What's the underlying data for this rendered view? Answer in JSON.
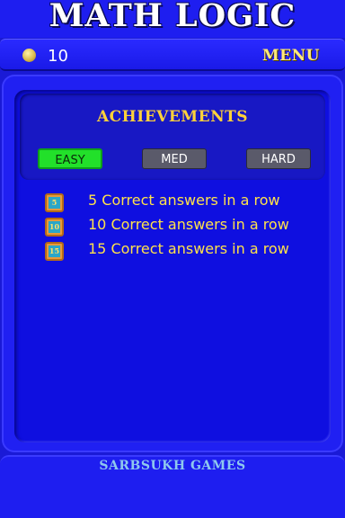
{
  "app": {
    "title": "MATH LOGIC"
  },
  "status": {
    "coins": "10",
    "menu_label": "MENU"
  },
  "achievements": {
    "title": "ACHIEVEMENTS",
    "tabs": [
      {
        "label": "EASY",
        "selected": true
      },
      {
        "label": "MED",
        "selected": false
      },
      {
        "label": "HARD",
        "selected": false
      }
    ],
    "items": [
      {
        "badge": "5",
        "text": "5 Correct answers in a row"
      },
      {
        "badge": "10",
        "text": "10 Correct answers in a row"
      },
      {
        "badge": "15",
        "text": "15 Correct answers in a row"
      }
    ]
  },
  "footer": {
    "text": "SARBSUKH GAMES"
  },
  "colors": {
    "background": "#1a1ad6",
    "selected_tab": "#22e02a",
    "unselected_tab": "#5a5a6a",
    "achievement_text": "#ffe24a",
    "title_accent": "#ffd23a"
  }
}
